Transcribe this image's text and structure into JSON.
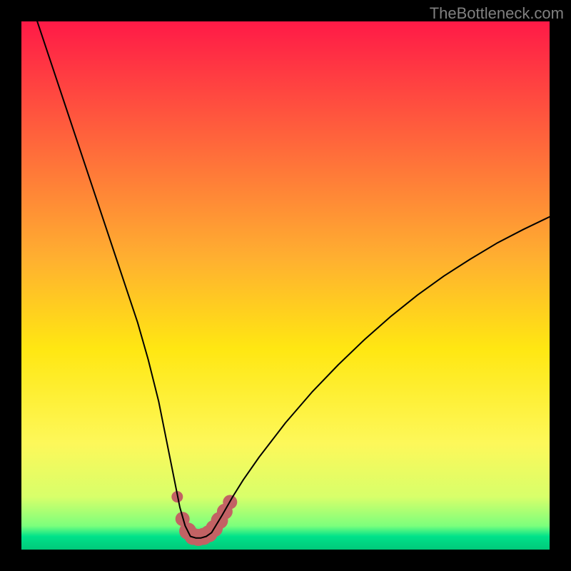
{
  "watermark": "TheBottleneck.com",
  "chart_data": {
    "type": "line",
    "title": "",
    "xlabel": "",
    "ylabel": "",
    "xlim": [
      0,
      100
    ],
    "ylim": [
      0,
      100
    ],
    "background_gradient": {
      "stops": [
        {
          "offset": 0.0,
          "color": "#ff1a47"
        },
        {
          "offset": 0.45,
          "color": "#ffb030"
        },
        {
          "offset": 0.62,
          "color": "#ffe712"
        },
        {
          "offset": 0.8,
          "color": "#fdf85a"
        },
        {
          "offset": 0.9,
          "color": "#d8ff6a"
        },
        {
          "offset": 0.955,
          "color": "#7cff7c"
        },
        {
          "offset": 0.975,
          "color": "#00e28a"
        },
        {
          "offset": 1.0,
          "color": "#00c97a"
        }
      ]
    },
    "series": [
      {
        "name": "bottleneck-curve",
        "color": "#000000",
        "stroke_width": 2,
        "x": [
          3,
          4,
          5,
          6,
          7,
          8,
          10,
          12,
          14,
          16,
          18,
          20,
          22,
          24,
          26,
          27,
          28,
          29,
          30,
          31,
          32,
          33,
          34,
          35,
          36,
          38,
          40,
          42,
          45,
          50,
          55,
          60,
          65,
          70,
          75,
          80,
          85,
          90,
          95,
          100
        ],
        "y": [
          100,
          97,
          94,
          91,
          88,
          85,
          79,
          73,
          67,
          61,
          55,
          49,
          43,
          36,
          28,
          23,
          18,
          13,
          8,
          4.5,
          2.5,
          2.2,
          2.2,
          2.5,
          3.2,
          6.5,
          10,
          13.2,
          17.5,
          24,
          29.8,
          35,
          39.8,
          44.2,
          48.2,
          51.8,
          55,
          58,
          60.6,
          63
        ]
      }
    ],
    "highlight": {
      "name": "optimal-region",
      "color": "#c26264",
      "points": [
        {
          "x": 29.5,
          "y": 10.0,
          "r": 8
        },
        {
          "x": 30.5,
          "y": 5.8,
          "r": 10
        },
        {
          "x": 31.5,
          "y": 3.5,
          "r": 12
        },
        {
          "x": 32.5,
          "y": 2.5,
          "r": 12
        },
        {
          "x": 33.5,
          "y": 2.3,
          "r": 12
        },
        {
          "x": 34.5,
          "y": 2.5,
          "r": 12
        },
        {
          "x": 35.5,
          "y": 3.0,
          "r": 12
        },
        {
          "x": 36.5,
          "y": 4.0,
          "r": 12
        },
        {
          "x": 37.5,
          "y": 5.5,
          "r": 12
        },
        {
          "x": 38.5,
          "y": 7.2,
          "r": 11
        },
        {
          "x": 39.5,
          "y": 9.0,
          "r": 10
        }
      ]
    }
  }
}
